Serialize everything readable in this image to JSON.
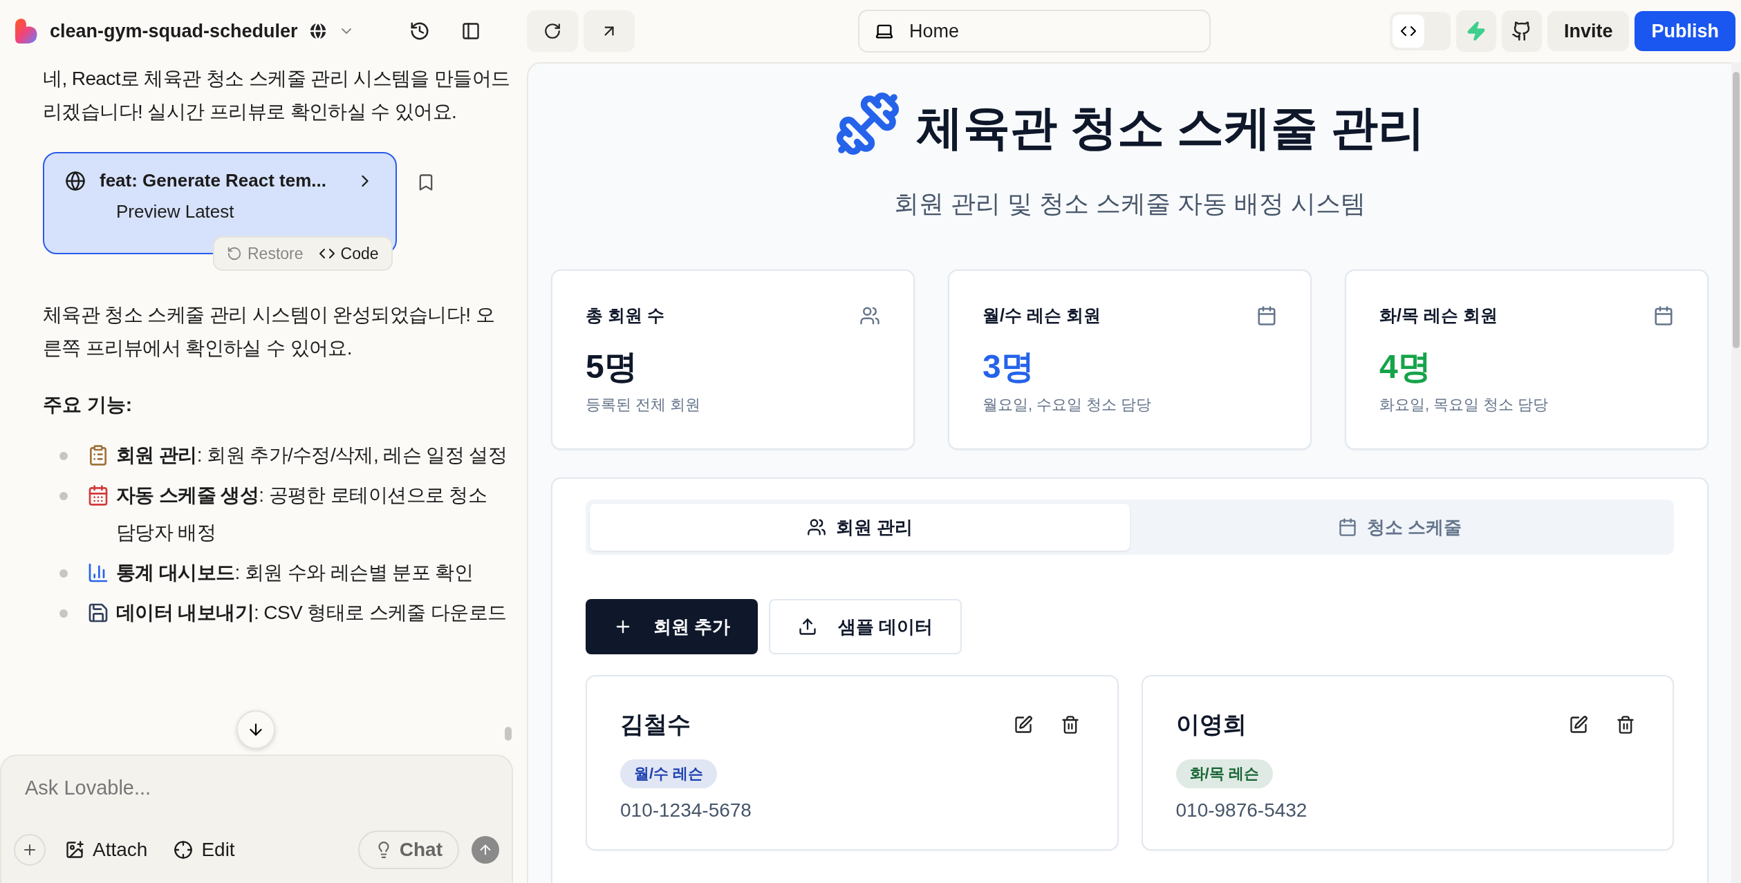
{
  "topbar": {
    "project_name": "clean-gym-squad-scheduler",
    "address": "Home",
    "code_toggle": {
      "on": true
    },
    "invite": "Invite",
    "publish": "Publish"
  },
  "chat": {
    "intro": "네, React로 체육관 청소 스케줄 관리 시스템을 만들어드리겠습니다! 실시간 프리뷰로 확인하실 수 있어요.",
    "commit": {
      "title": "feat: Generate React tem...",
      "subtitle": "Preview Latest",
      "restore": "Restore",
      "code": "Code"
    },
    "summary": "체육관 청소 스케줄 관리 시스템이 완성되었습니다! 오른쪽 프리뷰에서 확인하실 수 있어요.",
    "heading": "주요 기능:",
    "bullets": [
      "**회원 관리**: 회원 추가/수정/삭제, 레슨 일정 설정",
      "**자동 스케줄 생성**: 공평한 로테이션으로 청소 담당자 배정",
      "**통계 대시보드**: 회원 수와 레슨별 분포 확인",
      "**데이터 내보내기**: CSV 형태로 스케줄 다운로드"
    ]
  },
  "composer": {
    "placeholder": "Ask Lovable...",
    "attach": "Attach",
    "edit": "Edit",
    "chat": "Chat"
  },
  "preview": {
    "title": "체육관 청소 스케줄 관리",
    "subtitle": "회원 관리 및 청소 스케줄 자동 배정 시스템",
    "stats": [
      {
        "label": "총 회원 수",
        "value": "5명",
        "caption": "등록된 전체 회원",
        "color": "#0f172a"
      },
      {
        "label": "월/수 레슨 회원",
        "value": "3명",
        "caption": "월요일, 수요일 청소 담당",
        "color": "#2563eb"
      },
      {
        "label": "화/목 레슨 회원",
        "value": "4명",
        "caption": "화요일, 목요일 청소 담당",
        "color": "#16a34a"
      }
    ],
    "tabs": [
      {
        "label": "회원 관리",
        "selected": true
      },
      {
        "label": "청소 스케줄",
        "selected": false
      }
    ],
    "add_button": "회원 추가",
    "sample_button": "샘플 데이터",
    "members": [
      {
        "name": "김철수",
        "lesson": "월/수 레슨",
        "color": "#1e40af",
        "phone": "010-1234-5678"
      },
      {
        "name": "이영희",
        "lesson": "화/목 레슨",
        "color": "#166534",
        "phone": "010-9876-5432"
      }
    ]
  }
}
